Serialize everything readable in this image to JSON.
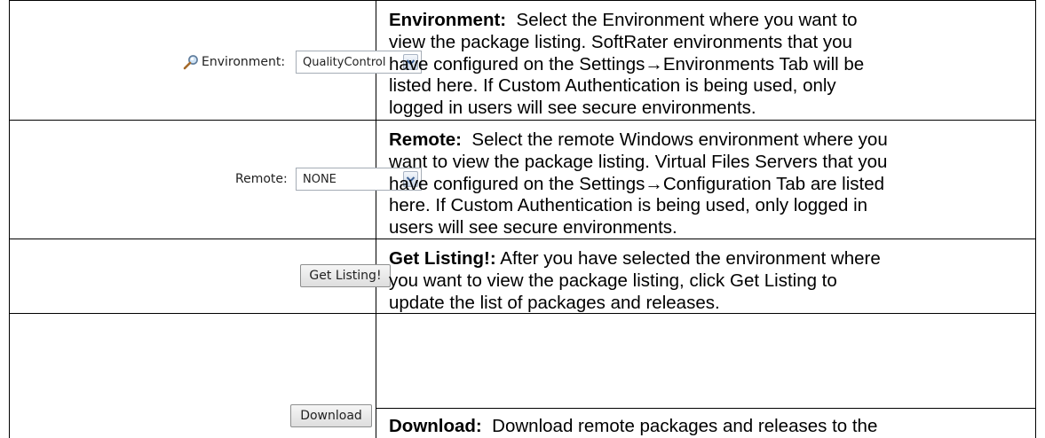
{
  "rows": [
    {
      "control": {
        "label": "Environment:",
        "selected_value": "QualityControl"
      },
      "description": {
        "term": "Environment:",
        "lines": [
          "Select the Environment where you want to",
          "view the package listing. SoftRater environments that you",
          "have configured on the Settings→Environments Tab will be",
          "listed here. If Custom Authentication is being used, only",
          "logged in users will see secure environments."
        ]
      }
    },
    {
      "control": {
        "label": "Remote:",
        "selected_value": "NONE"
      },
      "description": {
        "term": "Remote:",
        "lines": [
          "Select the remote Windows environment where you",
          "want to view the package listing. Virtual Files Servers that you",
          "have configured on the Settings→Configuration Tab are listed",
          "here. If Custom Authentication is being used, only logged in",
          "users will see secure environments."
        ]
      }
    },
    {
      "control": {
        "button_label": "Get Listing!"
      },
      "description": {
        "term": "Get Listing!:",
        "lines": [
          "After you have selected the environment where",
          "you want to view the package listing, click Get Listing to",
          "update the list of packages and releases."
        ]
      }
    },
    {
      "control": {
        "button_label": "Download"
      },
      "description": {
        "term": "Download:",
        "lines": [
          "Download remote packages and releases to the"
        ]
      }
    }
  ],
  "icons": {
    "environment": "magnifier-icon",
    "dropdown": "chevron-down-icon"
  }
}
